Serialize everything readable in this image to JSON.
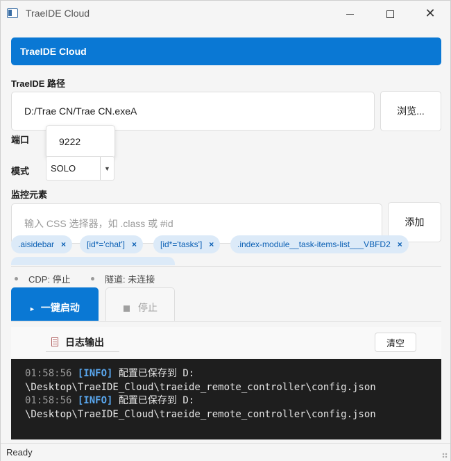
{
  "window": {
    "title": "TraeIDE Cloud"
  },
  "banner": {
    "title": "TraeIDE Cloud"
  },
  "path": {
    "label": "TraeIDE 路径",
    "value": "D:/Trae CN/Trae CN.exeA",
    "browse_label": "浏览..."
  },
  "port": {
    "label": "端口",
    "value": "9222"
  },
  "mode": {
    "label": "模式",
    "selected": "SOLO"
  },
  "monitor": {
    "label": "监控元素",
    "placeholder": "输入 CSS 选择器，如 .class 或 #id",
    "add_label": "添加",
    "tags": [
      ".aisidebar",
      "[id*='chat']",
      "[id*='tasks']",
      ".index-module__task-items-list___VBFD2"
    ],
    "remove_glyph": "×"
  },
  "status": {
    "cdp": "CDP: 停止",
    "tunnel": "隧道: 未连接"
  },
  "actions": {
    "start_label": "一键启动",
    "stop_label": "停止"
  },
  "log": {
    "title": "日志输出",
    "clear_label": "清空",
    "lines": [
      {
        "time": "01:58:56",
        "level": "[INFO]",
        "text": "配置已保存到 D:",
        "cont": "\\Desktop\\TraeIDE_Cloud\\traeide_remote_controller\\config.json"
      },
      {
        "time": "01:58:56",
        "level": "[INFO]",
        "text": "配置已保存到 D:",
        "cont": "\\Desktop\\TraeIDE_Cloud\\traeide_remote_controller\\config.json"
      }
    ]
  },
  "statusbar": {
    "text": "Ready"
  },
  "colors": {
    "accent": "#0a78d4",
    "tag_bg": "#dceaf8",
    "log_bg": "#1e1e1e"
  }
}
